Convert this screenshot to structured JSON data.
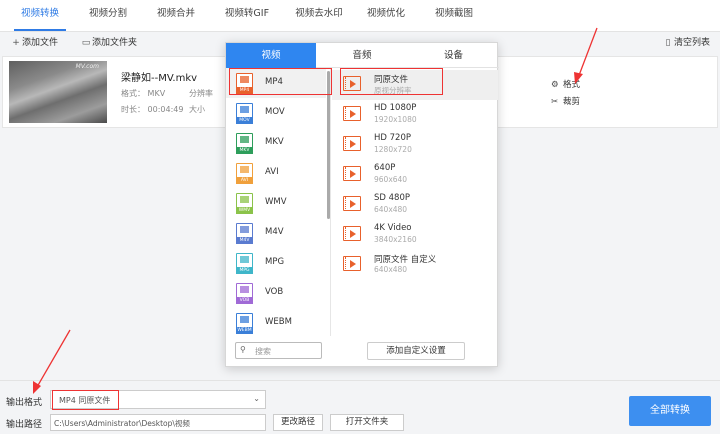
{
  "tabs": [
    "视频转换",
    "视频分割",
    "视频合并",
    "视频转GIF",
    "视频去水印",
    "视频优化",
    "视频截图"
  ],
  "toolbar": {
    "add_file": "添加文件",
    "add_folder": "添加文件夹",
    "clear_list": "清空列表"
  },
  "file": {
    "name": "梁静如--MV.mkv",
    "thumb_watermark": "MV.com",
    "format_label": "格式：",
    "format_value": "MKV",
    "resolution_label": "分辨率",
    "duration_label": "时长：",
    "duration_value": "00:04:49",
    "size_label": "大小",
    "action_format": "格式",
    "action_cut": "裁剪"
  },
  "panel": {
    "tabs": [
      "视频",
      "音频",
      "设备"
    ],
    "active_tab": "视频",
    "formats": [
      {
        "name": "MP4",
        "color": "#e8612c"
      },
      {
        "name": "MOV",
        "color": "#3b7fd8"
      },
      {
        "name": "MKV",
        "color": "#2e9e5b"
      },
      {
        "name": "AVI",
        "color": "#f0a03c"
      },
      {
        "name": "WMV",
        "color": "#8bc34a"
      },
      {
        "name": "M4V",
        "color": "#5a7bd0"
      },
      {
        "name": "MPG",
        "color": "#3fb6c9"
      },
      {
        "name": "VOB",
        "color": "#a06ad6"
      },
      {
        "name": "WEBM",
        "color": "#3b7fd8"
      }
    ],
    "selected_format": "MP4",
    "presets": [
      {
        "name": "同原文件",
        "res": "原视分辨率"
      },
      {
        "name": "HD 1080P",
        "res": "1920x1080"
      },
      {
        "name": "HD 720P",
        "res": "1280x720"
      },
      {
        "name": "640P",
        "res": "960x640"
      },
      {
        "name": "SD 480P",
        "res": "640x480"
      },
      {
        "name": "4K Video",
        "res": "3840x2160"
      },
      {
        "name": "同原文件 自定义",
        "res": "640x480"
      }
    ],
    "search_placeholder": "搜索",
    "add_custom": "添加自定义设置"
  },
  "bottom": {
    "output_format_label": "输出格式",
    "output_format_value": "MP4  同原文件",
    "output_path_label": "输出路径",
    "output_path_value": "C:\\Users\\Administrator\\Desktop\\视频",
    "change_path": "更改路径",
    "open_folder": "打开文件夹",
    "convert_all": "全部转换"
  },
  "colors": {
    "accent": "#2f86f0",
    "highlight": "#ee3333"
  }
}
